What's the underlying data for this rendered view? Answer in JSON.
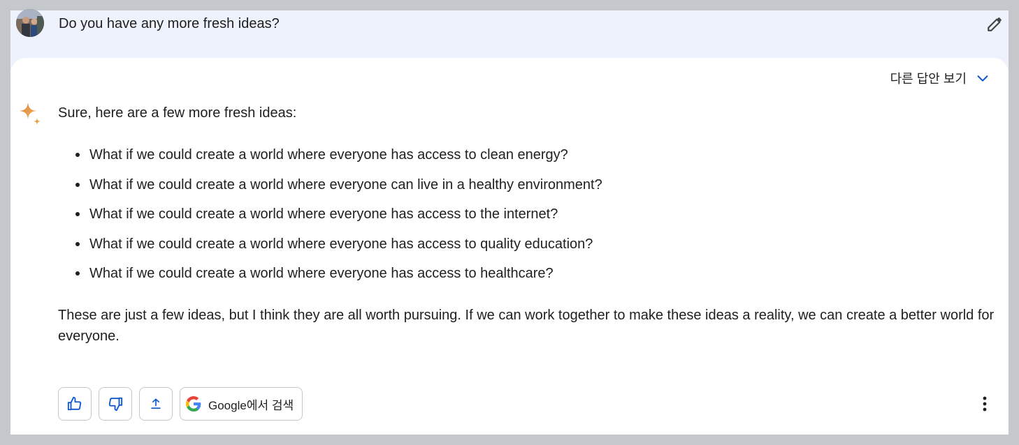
{
  "prompt": {
    "text": "Do you have any more fresh ideas?",
    "avatar_icon": "user-avatar",
    "edit_icon": "pencil-icon"
  },
  "response": {
    "drafts_label": "다른 답안 보기",
    "intro": "Sure, here are a few more fresh ideas:",
    "ideas": [
      "What if we could create a world where everyone has access to clean energy?",
      "What if we could create a world where everyone can live in a healthy environment?",
      "What if we could create a world where everyone has access to the internet?",
      "What if we could create a world where everyone has access to quality education?",
      "What if we could create a world where everyone has access to healthcare?"
    ],
    "outro": "These are just a few ideas, but I think they are all worth pursuing. If we can work together to make these ideas a reality, we can create a better world for everyone."
  },
  "actions": {
    "google_search_label": "Google에서 검색",
    "icons": [
      "thumbs-up-icon",
      "thumbs-down-icon",
      "share-icon",
      "google-logo-icon",
      "more-vert-icon"
    ]
  },
  "colors": {
    "page_border": "#c4c7cc",
    "prompt_bg": "#eef2fc",
    "card_bg": "#ffffff",
    "text": "#1f1f1f",
    "accent_blue": "#0b57d0",
    "sparkle_gold": "#e8a24c"
  }
}
